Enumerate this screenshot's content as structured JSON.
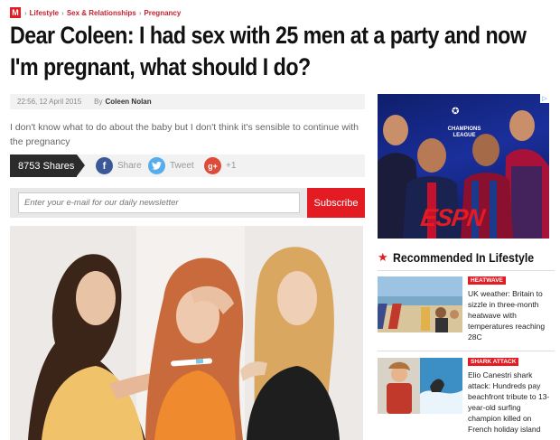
{
  "breadcrumb": {
    "logo": "M",
    "items": [
      "Lifestyle",
      "Sex & Relationships",
      "Pregnancy"
    ],
    "separator": "›"
  },
  "article": {
    "headline": "Dear Coleen: I had sex with 25 men at a party and now I'm pregnant, what should I do?",
    "timestamp": "22:56, 12 April 2015",
    "by_label": "By",
    "author": "Coleen Nolan",
    "standfirst": "I don't know what to do about the baby but I don't think it's sensible to continue with the pregnancy"
  },
  "share": {
    "count_label": "8753 Shares",
    "facebook_label": "Share",
    "twitter_label": "Tweet",
    "gplus_label": "+1",
    "colors": {
      "facebook": "#3b5998",
      "twitter": "#55acee",
      "gplus": "#dd4b39"
    }
  },
  "newsletter": {
    "placeholder": "Enter your e-mail for our daily newsletter",
    "button_label": "Subscribe"
  },
  "ad": {
    "competition": "CHAMPIONS LEAGUE",
    "brand": "ESPN",
    "badge_icon": "play-triangle-icon"
  },
  "sidebar": {
    "title": "Recommended In Lifestyle",
    "items": [
      {
        "tag": "HEATWAVE",
        "text": "UK weather: Britain to sizzle in three-month heatwave with temperatures reaching 28C"
      },
      {
        "tag": "SHARK ATTACK",
        "text": "Elio Canestri shark attack: Hundreds pay beachfront tribute to 13-year-old surfing champion killed on French holiday island"
      }
    ]
  },
  "colors": {
    "accent": "#e31b23",
    "dark": "#2b2b2b"
  }
}
